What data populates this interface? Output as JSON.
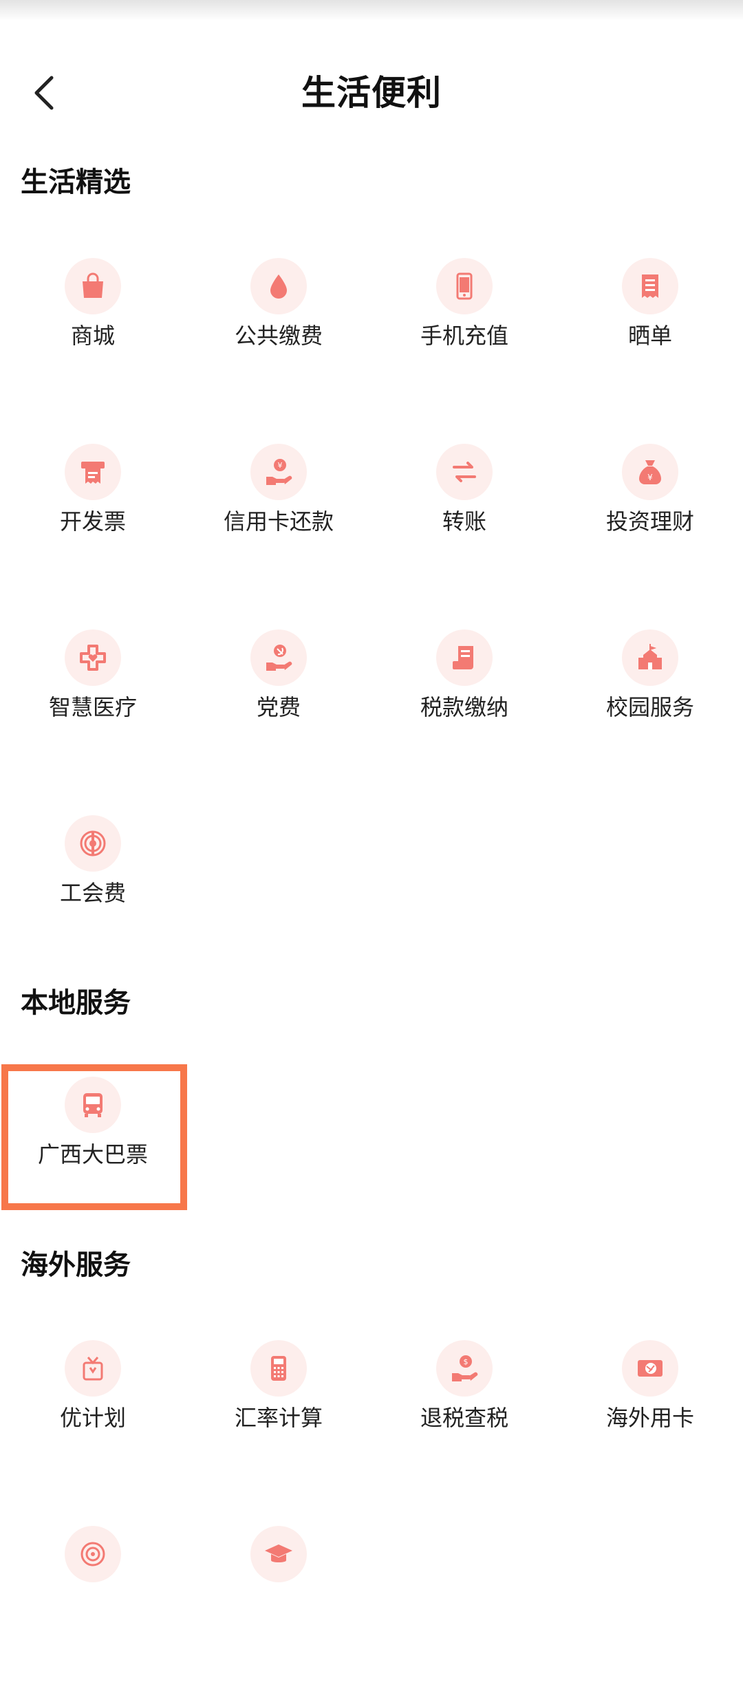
{
  "header": {
    "title": "生活便利",
    "back_icon": "chevron-left-icon"
  },
  "accent_color": "#f37a73",
  "highlight_color": "#f7774a",
  "sections": [
    {
      "title": "生活精选",
      "items": [
        {
          "label": "商城",
          "icon": "shopping-bag-icon"
        },
        {
          "label": "公共缴费",
          "icon": "water-drop-icon"
        },
        {
          "label": "手机充值",
          "icon": "mobile-phone-icon"
        },
        {
          "label": "晒单",
          "icon": "receipt-icon"
        },
        {
          "label": "开发票",
          "icon": "invoice-printer-icon"
        },
        {
          "label": "信用卡还款",
          "icon": "hand-yuan-icon"
        },
        {
          "label": "转账",
          "icon": "transfer-arrows-icon"
        },
        {
          "label": "投资理财",
          "icon": "money-bag-icon"
        },
        {
          "label": "智慧医疗",
          "icon": "medical-cross-icon"
        },
        {
          "label": "党费",
          "icon": "hand-party-icon"
        },
        {
          "label": "税款缴纳",
          "icon": "tax-document-icon"
        },
        {
          "label": "校园服务",
          "icon": "school-building-icon"
        },
        {
          "label": "工会费",
          "icon": "union-emblem-icon"
        }
      ]
    },
    {
      "title": "本地服务",
      "items": [
        {
          "label": "广西大巴票",
          "icon": "bus-icon"
        }
      ]
    },
    {
      "title": "海外服务",
      "items": [
        {
          "label": "优计划",
          "icon": "gift-icon"
        },
        {
          "label": "汇率计算",
          "icon": "calculator-icon"
        },
        {
          "label": "退税查税",
          "icon": "hand-dollar-icon"
        },
        {
          "label": "海外用卡",
          "icon": "globe-card-icon"
        },
        {
          "label": "",
          "icon": "target-icon"
        },
        {
          "label": "",
          "icon": "graduation-cap-icon"
        }
      ]
    }
  ]
}
